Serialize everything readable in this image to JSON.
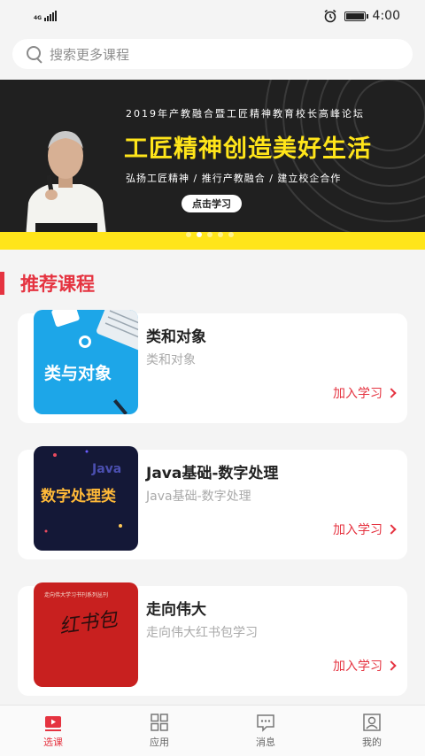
{
  "status": {
    "network": "4G",
    "time": "4:00"
  },
  "search": {
    "placeholder": "搜索更多课程"
  },
  "banner": {
    "subtitle": "2019年产教融合暨工匠精神教育校长高峰论坛",
    "title": "工匠精神创造美好生活",
    "tagline": "弘扬工匠精神  /  推行产教融合  /  建立校企合作",
    "button": "点击学习",
    "dots": 5,
    "active_dot": 1
  },
  "section": {
    "title": "推荐课程"
  },
  "courses": [
    {
      "name": "类和对象",
      "desc": "类和对象",
      "action": "加入学习",
      "thumb_text": "类与对象"
    },
    {
      "name": "Java基础-数字处理",
      "desc": "Java基础-数字处理",
      "action": "加入学习",
      "thumb_text": "数字处理类",
      "thumb_sub": "Java"
    },
    {
      "name": "走向伟大",
      "desc": "走向伟大红书包学习",
      "action": "加入学习",
      "thumb_text": "红书包",
      "thumb_sub": "走向伟大学习书刊系列丛刊"
    }
  ],
  "tabs": [
    {
      "label": "选课",
      "icon": "play-icon",
      "active": true
    },
    {
      "label": "应用",
      "icon": "grid-icon",
      "active": false
    },
    {
      "label": "消息",
      "icon": "message-icon",
      "active": false
    },
    {
      "label": "我的",
      "icon": "user-icon",
      "active": false
    }
  ],
  "colors": {
    "accent": "#e53340",
    "banner_yellow": "#ffe51a",
    "banner_dark": "#202020"
  }
}
